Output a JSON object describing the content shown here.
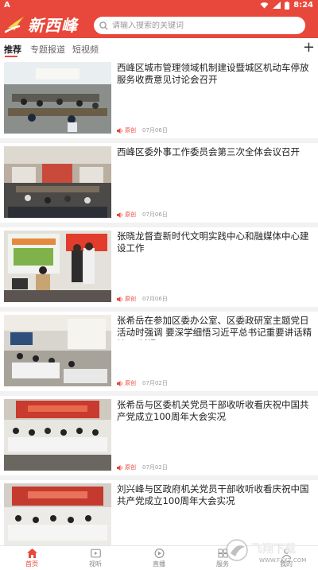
{
  "status_bar": {
    "app_letter": "A",
    "time": "8:24"
  },
  "header": {
    "brand": "新西峰",
    "search_placeholder": "请输入搜索的关键词"
  },
  "tabs": [
    {
      "label": "推荐",
      "active": true
    },
    {
      "label": "专题报道",
      "active": false
    },
    {
      "label": "短视频",
      "active": false
    }
  ],
  "tab_add_label": "+",
  "feed": [
    {
      "title": "西峰区城市管理领域机制建设暨城区机动车停放服务收费意见讨论会召开",
      "source": "原创",
      "date": "07月06日"
    },
    {
      "title": "西峰区委外事工作委员会第三次全体会议召开",
      "source": "原创",
      "date": "07月06日"
    },
    {
      "title": "张晓龙督查新时代文明实践中心和融媒体中心建设工作",
      "source": "原创",
      "date": "07月06日"
    },
    {
      "title": "张希岳在参加区委办公室、区委政研室主题党日活动时强调 要深学细悟习近平总书记重要讲话精神 不断提...",
      "source": "原创",
      "date": "07月02日"
    },
    {
      "title": "张希岳与区委机关党员干部收听收看庆祝中国共产党成立100周年大会实况",
      "source": "原创",
      "date": "07月02日"
    },
    {
      "title": "刘兴峰与区政府机关党员干部收听收看庆祝中国共产党成立100周年大会实况",
      "source": "原创",
      "date": "07月02日"
    }
  ],
  "bottom_tabs": [
    {
      "label": "首页",
      "icon": "home-icon",
      "active": true
    },
    {
      "label": "视听",
      "icon": "tv-icon",
      "active": false
    },
    {
      "label": "直播",
      "icon": "play-icon",
      "active": false
    },
    {
      "label": "服务",
      "icon": "service-icon",
      "active": false
    },
    {
      "label": "我的",
      "icon": "user-icon",
      "active": false
    }
  ],
  "watermark": {
    "text": "飞翔下载",
    "url": "WWW.FXXZ.COM"
  },
  "colors": {
    "brand": "#e8483b",
    "date": "#999999",
    "background": "#f2f2f2"
  }
}
